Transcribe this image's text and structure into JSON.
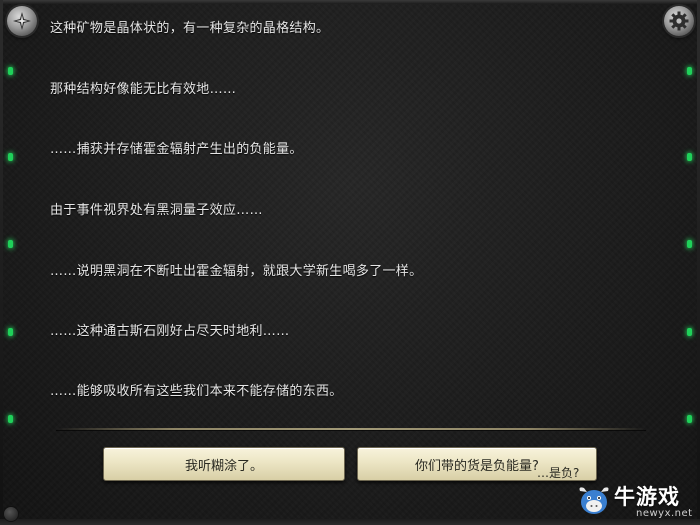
{
  "dialog": {
    "lines": [
      "这种矿物是晶体状的，有一种复杂的晶格结构。",
      "那种结构好像能无比有效地……",
      "……捕获并存储霍金辐射产生出的负能量。",
      "由于事件视界处有黑洞量子效应……",
      "……说明黑洞在不断吐出霍金辐射，就跟大学新生喝多了一样。",
      "……这种通古斯石刚好占尽天时地利……",
      "……能够吸收所有这些我们本来不能存储的东西。"
    ]
  },
  "choices": [
    {
      "label": "我听糊涂了。"
    },
    {
      "label": "你们带的货是负能量?"
    }
  ],
  "choice_overlap_text": "…是负?",
  "icons": {
    "menu": "compass-star-icon",
    "settings": "gear-icon"
  },
  "colors": {
    "indicator_led": "#1fd15a",
    "choice_bg": "#ece5c4",
    "dialog_text": "#e6e6e6"
  },
  "watermark": {
    "brand": "牛游戏",
    "domain": "newyx.net"
  }
}
